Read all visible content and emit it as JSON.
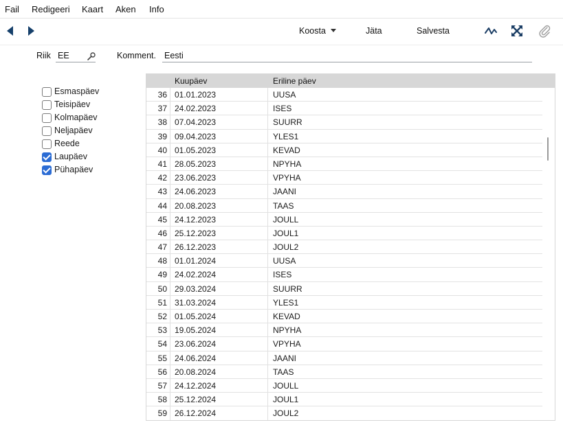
{
  "menu": [
    {
      "label": "Fail"
    },
    {
      "label": "Redigeeri"
    },
    {
      "label": "Kaart"
    },
    {
      "label": "Aken"
    },
    {
      "label": "Info"
    }
  ],
  "toolbar": {
    "koosta_label": "Koosta",
    "jata_label": "Jäta",
    "salvesta_label": "Salvesta",
    "icons": [
      "back-arrow-icon",
      "forward-arrow-icon",
      "activity-icon",
      "expand-icon",
      "paperclip-icon"
    ]
  },
  "form": {
    "riik_label": "Riik",
    "riik_value": "EE",
    "komment_label": "Komment.",
    "komment_value": "Eesti"
  },
  "weekdays": [
    {
      "label": "Esmaspäev",
      "checked": false
    },
    {
      "label": "Teisipäev",
      "checked": false
    },
    {
      "label": "Kolmapäev",
      "checked": false
    },
    {
      "label": "Neljapäev",
      "checked": false
    },
    {
      "label": "Reede",
      "checked": false
    },
    {
      "label": "Laupäev",
      "checked": true
    },
    {
      "label": "Pühapäev",
      "checked": true
    }
  ],
  "table": {
    "columns": [
      "Kuupäev",
      "Eriline päev"
    ],
    "rows": [
      {
        "no": "36",
        "date": "01.01.2023",
        "code": "UUSA"
      },
      {
        "no": "37",
        "date": "24.02.2023",
        "code": "ISES"
      },
      {
        "no": "38",
        "date": "07.04.2023",
        "code": "SUURR"
      },
      {
        "no": "39",
        "date": "09.04.2023",
        "code": "YLES1"
      },
      {
        "no": "40",
        "date": "01.05.2023",
        "code": "KEVAD"
      },
      {
        "no": "41",
        "date": "28.05.2023",
        "code": "NPYHA"
      },
      {
        "no": "42",
        "date": "23.06.2023",
        "code": "VPYHA"
      },
      {
        "no": "43",
        "date": "24.06.2023",
        "code": "JAANI"
      },
      {
        "no": "44",
        "date": "20.08.2023",
        "code": "TAAS"
      },
      {
        "no": "45",
        "date": "24.12.2023",
        "code": "JOULL"
      },
      {
        "no": "46",
        "date": "25.12.2023",
        "code": "JOUL1"
      },
      {
        "no": "47",
        "date": "26.12.2023",
        "code": "JOUL2"
      },
      {
        "no": "48",
        "date": "01.01.2024",
        "code": "UUSA"
      },
      {
        "no": "49",
        "date": "24.02.2024",
        "code": "ISES"
      },
      {
        "no": "50",
        "date": "29.03.2024",
        "code": "SUURR"
      },
      {
        "no": "51",
        "date": "31.03.2024",
        "code": "YLES1"
      },
      {
        "no": "52",
        "date": "01.05.2024",
        "code": "KEVAD"
      },
      {
        "no": "53",
        "date": "19.05.2024",
        "code": "NPYHA"
      },
      {
        "no": "54",
        "date": "23.06.2024",
        "code": "VPYHA"
      },
      {
        "no": "55",
        "date": "24.06.2024",
        "code": "JAANI"
      },
      {
        "no": "56",
        "date": "20.08.2024",
        "code": "TAAS"
      },
      {
        "no": "57",
        "date": "24.12.2024",
        "code": "JOULL"
      },
      {
        "no": "58",
        "date": "25.12.2024",
        "code": "JOUL1"
      },
      {
        "no": "59",
        "date": "26.12.2024",
        "code": "JOUL2"
      }
    ]
  },
  "colors": {
    "accent": "#2b6cd4",
    "nav_arrow": "#16406b",
    "header_bg": "#d7d7d7"
  }
}
